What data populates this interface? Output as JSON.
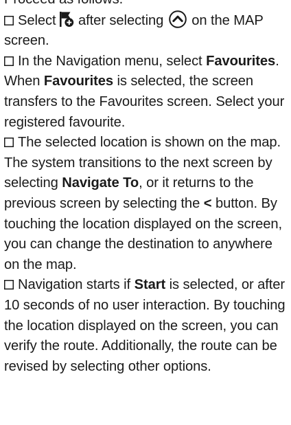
{
  "intro": "Proceed as follows.",
  "step1": {
    "part1": "Select",
    "part2": "after selecting",
    "part3": "on the MAP screen."
  },
  "step2": {
    "part1": "In the Navigation menu, select",
    "bold1": "Favourites",
    "part2": ". When",
    "bold2": "Favourites",
    "part3": "is selected, the screen transfers to the Favourites screen. Select your registered favourite."
  },
  "step3": {
    "part1": "The selected location is shown on the map. The system transitions to the next screen by selecting",
    "bold1": "Navigate To",
    "part2": ", or it returns to the previous screen by selecting the",
    "bold2": "<",
    "part3": "button. By touching the location displayed on the screen, you can change the destination to anywhere on the map."
  },
  "step4": {
    "part1": "Navigation starts if",
    "bold1": "Start",
    "part2": "is selected, or after 10 seconds of no user interaction. By touching the location displayed on the screen, you can verify the route. Additionally, the route can be revised by selecting other options."
  },
  "icons": {
    "checkbox": "checkbox-icon",
    "flag_add": "flag-add-icon",
    "up_circle": "chevron-up-circle-icon"
  }
}
